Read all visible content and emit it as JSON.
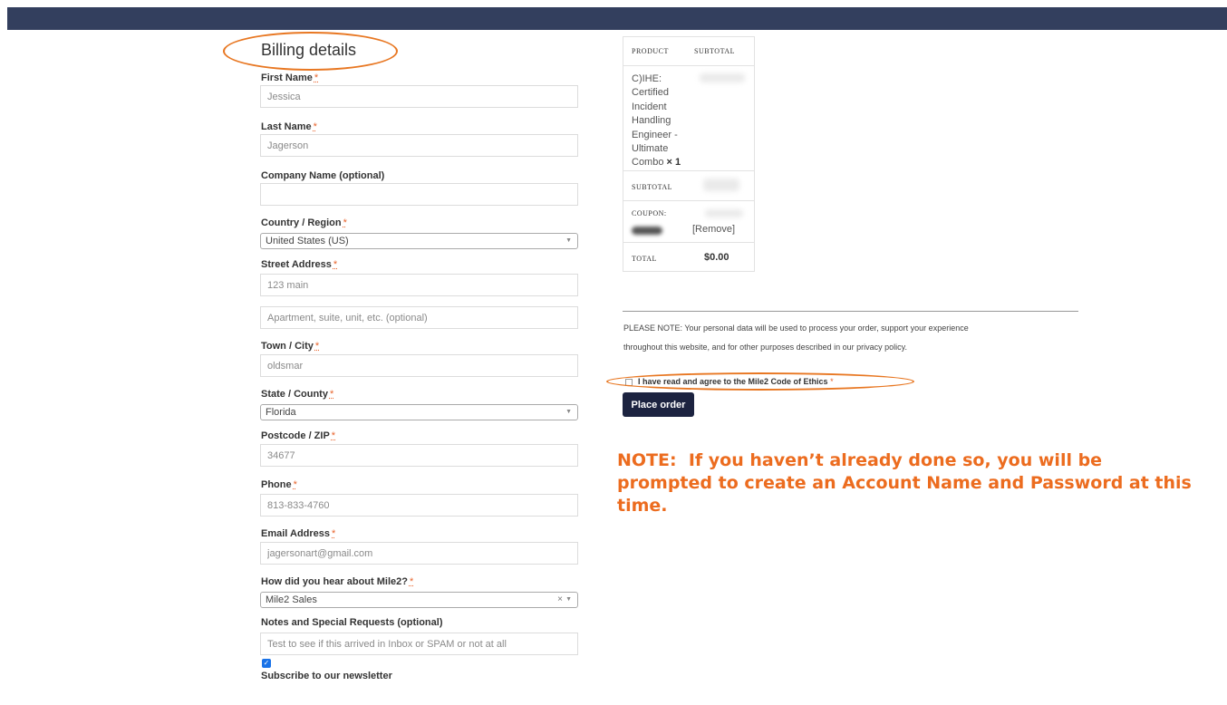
{
  "colors": {
    "topbar": "#333f5e",
    "annotation": "#e87722",
    "accent": "#ec6c1f",
    "button": "#1c2340"
  },
  "billing": {
    "title": "Billing details",
    "first_name": {
      "label": "First Name",
      "value": "Jessica"
    },
    "last_name": {
      "label": "Last Name",
      "value": "Jagerson"
    },
    "company": {
      "label": "Company Name (optional)",
      "value": ""
    },
    "country": {
      "label": "Country / Region",
      "value": "United States (US)"
    },
    "street": {
      "label": "Street Address",
      "value": "123 main",
      "apt_placeholder": "Apartment, suite, unit, etc. (optional)"
    },
    "city": {
      "label": "Town / City",
      "value": "oldsmar"
    },
    "state": {
      "label": "State / County",
      "value": "Florida"
    },
    "postcode": {
      "label": "Postcode / ZIP",
      "value": "34677"
    },
    "phone": {
      "label": "Phone",
      "value": "813-833-4760"
    },
    "email": {
      "label": "Email Address",
      "value": "jagersonart@gmail.com"
    },
    "referral": {
      "label": "How did you hear about Mile2?",
      "value": "Mile2 Sales"
    },
    "notes": {
      "label": "Notes and Special Requests (optional)",
      "value": "Test to see if this arrived in Inbox or SPAM or not at all"
    },
    "newsletter": {
      "label": "Subscribe to our newsletter",
      "checked": true
    },
    "required_marker": "*"
  },
  "order": {
    "col_product": "PRODUCT",
    "col_subtotal": "SUBTOTAL",
    "product_name": "C)IHE: Certified Incident Handling Engineer - Ultimate Combo",
    "qty": "× 1",
    "subtotal_label": "SUBTOTAL",
    "coupon_label": "COUPON:",
    "coupon_remove": "[Remove]",
    "total_label": "TOTAL",
    "total_value": "$0.00"
  },
  "privacy_note": "PLEASE NOTE: Your personal data will be used to process your order, support your experience throughout this website, and for other purposes described in our privacy policy.",
  "terms": {
    "label": "I have read and agree to the Mile2 Code of Ethics",
    "required": "*"
  },
  "place_order": "Place order",
  "big_note": "NOTE:  If you haven’t already done so, you will be\nprompted to create an Account Name and Password at this\ntime."
}
